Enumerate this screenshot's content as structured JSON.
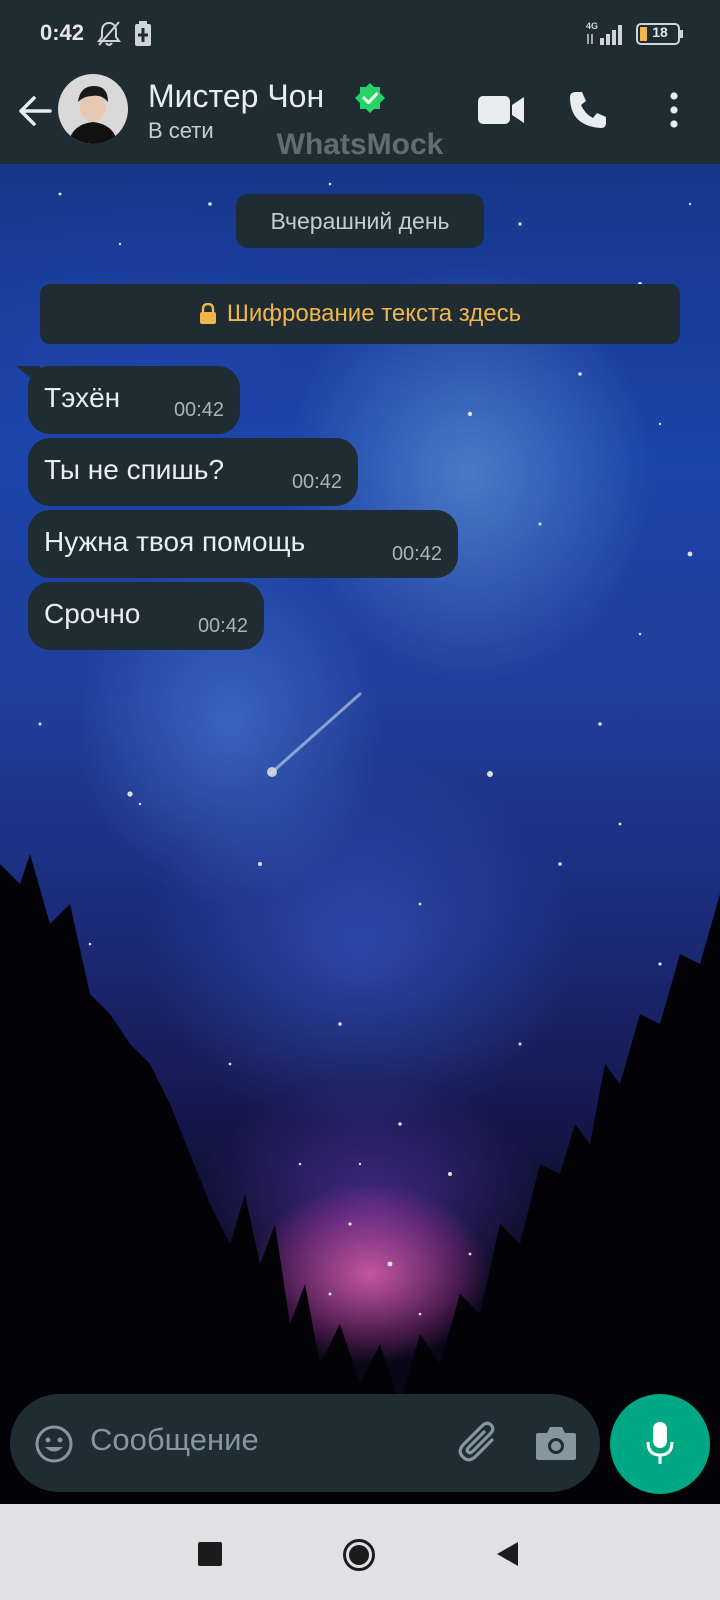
{
  "status_bar": {
    "time": "0:42",
    "network": "4G",
    "battery": "18"
  },
  "header": {
    "contact_name": "Мистер Чон",
    "presence": "В сети",
    "watermark": "WhatsMock",
    "verified_color": "#25d366",
    "icons": [
      "back-arrow-icon",
      "verified-badge-icon",
      "video-call-icon",
      "phone-icon",
      "more-options-icon"
    ]
  },
  "chat": {
    "date_chip": "Вчерашний день",
    "encryption_notice": "Шифрование текста здесь",
    "messages": [
      {
        "text": "Тэхён",
        "time": "00:42"
      },
      {
        "text": "Ты не спишь?",
        "time": "00:42"
      },
      {
        "text": "Нужна твоя помощь",
        "time": "00:42"
      },
      {
        "text": "Срочно",
        "time": "00:42"
      }
    ]
  },
  "composer": {
    "placeholder": "Сообщение",
    "icons": [
      "emoji-icon",
      "paperclip-icon",
      "camera-icon",
      "microphone-icon"
    ],
    "accent_color": "#00a884"
  },
  "navigation": {
    "icons": [
      "recents-square-icon",
      "home-circle-icon",
      "back-triangle-icon"
    ]
  }
}
